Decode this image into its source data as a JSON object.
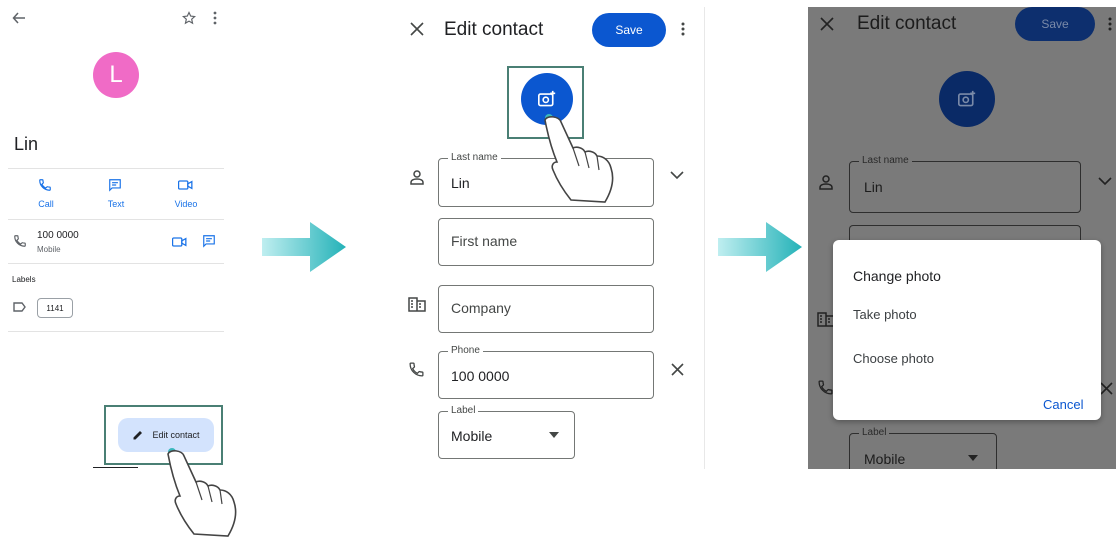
{
  "panel1": {
    "avatar_letter": "L",
    "contact_name": "Lin",
    "actions": [
      {
        "label": "Call",
        "icon": "phone-icon"
      },
      {
        "label": "Text",
        "icon": "message-icon"
      },
      {
        "label": "Video",
        "icon": "video-icon"
      }
    ],
    "phone_number": "100 0000",
    "phone_type": "Mobile",
    "labels_heading": "Labels",
    "label_chip": "1141",
    "edit_button": "Edit contact"
  },
  "panel2": {
    "title": "Edit contact",
    "save_label": "Save",
    "last_name_label": "Last name",
    "last_name_value": "Lin",
    "first_name_placeholder": "First name",
    "company_placeholder": "Company",
    "phone_label": "Phone",
    "phone_value": "100 0000",
    "type_label": "Label",
    "type_value": "Mobile"
  },
  "panel3": {
    "title": "Edit contact",
    "save_label": "Save",
    "last_name_label": "Last name",
    "last_name_value": "Lin",
    "type_label": "Label",
    "type_value": "Mobile",
    "dialog": {
      "title": "Change photo",
      "take_photo": "Take photo",
      "choose_photo": "Choose photo",
      "cancel": "Cancel"
    }
  },
  "colors": {
    "accent": "#0b57d0",
    "avatar": "#f06bc6",
    "arrow": "#3bb8bd",
    "highlight_box": "#4a7f74",
    "overlay": "#7a7a7a"
  }
}
